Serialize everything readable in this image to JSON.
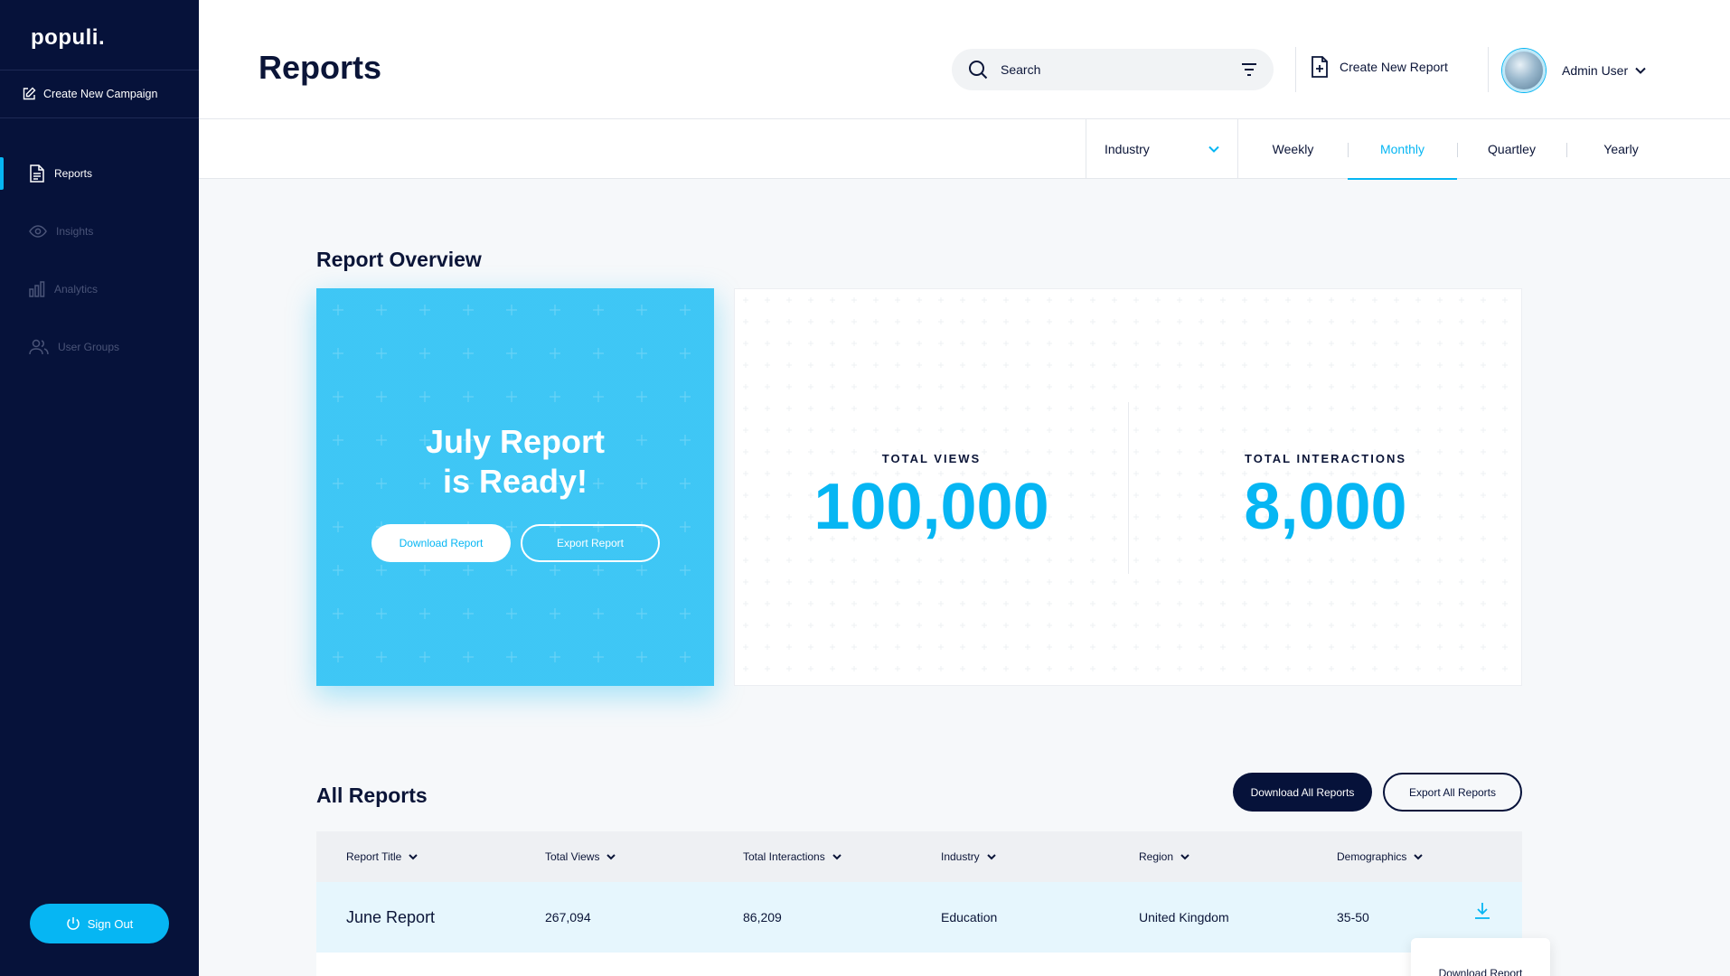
{
  "sidebar": {
    "logo": "populi.",
    "create_campaign": "Create New Campaign",
    "items": [
      {
        "label": "Reports",
        "icon": "document-icon",
        "active": true
      },
      {
        "label": "Insights",
        "icon": "eye-icon"
      },
      {
        "label": "Analytics",
        "icon": "bar-chart-icon"
      },
      {
        "label": "User Groups",
        "icon": "users-icon"
      }
    ],
    "sign_out": "Sign Out"
  },
  "header": {
    "title": "Reports",
    "search_placeholder": "Search",
    "create_report": "Create New Report",
    "user_name": "Admin User"
  },
  "filters": {
    "industry": "Industry",
    "periods": [
      "Weekly",
      "Monthly",
      "Quartley",
      "Yearly"
    ],
    "active_period": "Monthly"
  },
  "overview": {
    "title": "Report Overview",
    "ready_title_line1": "July Report",
    "ready_title_line2": "is Ready!",
    "download_report": "Download Report",
    "export_report": "Export Report",
    "total_views_label": "TOTAL VIEWS",
    "total_views_value": "100,000",
    "total_interactions_label": "TOTAL INTERACTIONS",
    "total_interactions_value": "8,000"
  },
  "all_reports": {
    "title": "All Reports",
    "download_all": "Download All Reports",
    "export_all": "Export All Reports",
    "columns": [
      "Report Title",
      "Total Views",
      "Total Interactions",
      "Industry",
      "Region",
      "Demographics"
    ],
    "rows": [
      {
        "title": "June Report",
        "views": "267,094",
        "interactions": "86,209",
        "industry": "Education",
        "region": "United Kingdom",
        "demographics": "35-50"
      }
    ],
    "tooltip": "Download Report"
  },
  "colors": {
    "accent": "#06b6f3",
    "navy": "#06123a"
  }
}
